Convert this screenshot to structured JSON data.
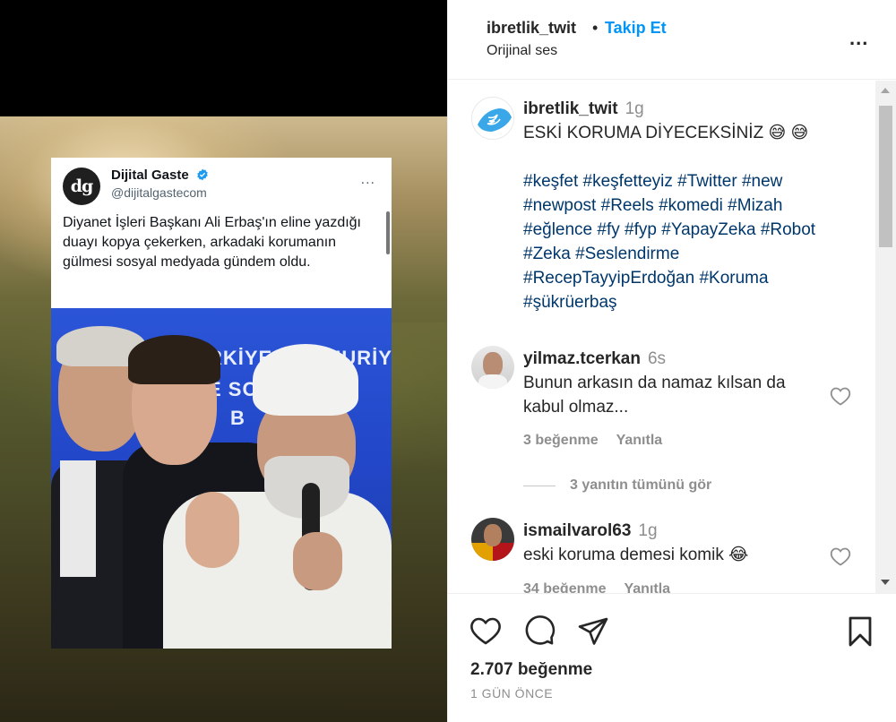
{
  "post": {
    "username": "ibretlik_twit",
    "separator": "•",
    "follow_label": "Takip Et",
    "audio_label": "Orijinal ses",
    "more_options_label": "..."
  },
  "media": {
    "tweet": {
      "account_name": "Dijital Gaste",
      "handle": "@dijitalgastecom",
      "avatar_text": "dg",
      "more_label": "...",
      "text": "Diyanet İşleri Başkanı Ali Erbaş'ın eline yazdığı duayı kopya çekerken, arkadaki korumanın gülmesi sosyal medyada gündem oldu."
    },
    "photo_banner": {
      "line1": "RKİYE CUMHURİYET",
      "line2": "E SO     MET",
      "line3": "B"
    }
  },
  "caption": {
    "username": "ibretlik_twit",
    "time": "1g",
    "text": "ESKİ KORUMA DİYECEKSİNİZ 😅 😅",
    "hashtags": [
      "#keşfet",
      "#keşfetteyiz",
      "#Twitter",
      "#new",
      "#newpost",
      "#Reels",
      "#komedi",
      "#Mizah",
      "#eğlence",
      "#fy",
      "#fyp",
      "#YapayZeka",
      "#Robot",
      "#Zeka",
      "#Seslendirme",
      "#RecepTayyipErdoğan",
      "#Koruma",
      "#şükrüerbaş"
    ]
  },
  "comments": [
    {
      "username": "yilmaz.tcerkan",
      "time": "6s",
      "text_line1": "Bunun arkasın da namaz kılsan da",
      "text_line2": "kabul olmaz...",
      "likes": "3 beğenme",
      "reply_label": "Yanıtla",
      "view_replies": "3 yanıtın tümünü gör"
    },
    {
      "username": "ismailvarol63",
      "time": "1g",
      "text": "eski koruma demesi komik 😂",
      "likes": "34 beğenme",
      "reply_label": "Yanıtla"
    }
  ],
  "actions": {
    "likes_count": "2.707 beğenme",
    "date": "1 GÜN ÖNCE"
  },
  "icons": [
    "verified-icon",
    "more-icon",
    "heart-icon",
    "comment-icon",
    "share-icon",
    "save-icon"
  ],
  "colors": {
    "link_blue": "#0095f6",
    "hashtag": "#00376b",
    "muted": "#8e8e8e",
    "text": "#262626"
  }
}
